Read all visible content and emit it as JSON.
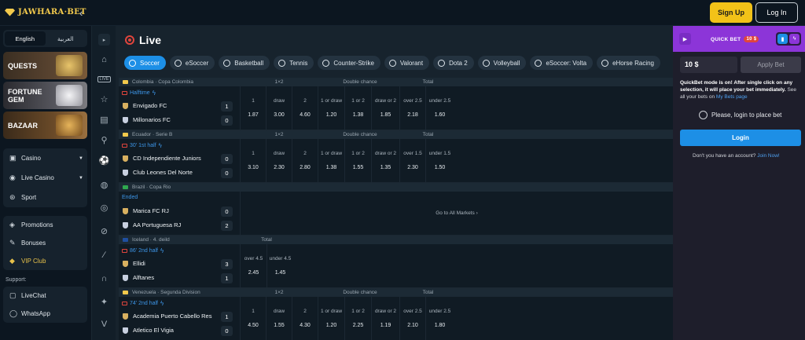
{
  "header": {
    "logo": "JAWHARA·BET",
    "collapse_icon": "chevron-left-icon",
    "signup": "Sign Up",
    "login": "Log In"
  },
  "sidebar": {
    "languages": [
      "English",
      "العربية"
    ],
    "promos": [
      "QUESTS",
      "FORTUNE GEM",
      "BAZAAR"
    ],
    "main_menu": [
      {
        "label": "Casino",
        "icon": "casino-icon"
      },
      {
        "label": "Live Casino",
        "icon": "live-casino-icon"
      },
      {
        "label": "Sport",
        "icon": "sport-icon"
      }
    ],
    "promo_menu": [
      {
        "label": "Promotions",
        "icon": "promotions-icon"
      },
      {
        "label": "Bonuses",
        "icon": "bonuses-icon"
      },
      {
        "label": "VIP Club",
        "icon": "vip-icon"
      }
    ],
    "support_label": "Support:",
    "support_menu": [
      {
        "label": "LiveChat",
        "icon": "chat-icon"
      },
      {
        "label": "WhatsApp",
        "icon": "whatsapp-icon"
      }
    ]
  },
  "iconbar": {
    "live_label": "LIVE"
  },
  "main": {
    "title": "Live",
    "sports": [
      "Soccer",
      "eSoccer",
      "Basketball",
      "Tennis",
      "Counter-Strike",
      "Valorant",
      "Dota 2",
      "Volleyball",
      "eSoccer: Volta",
      "eHorse Racing"
    ],
    "events": [
      {
        "league": "Colombia · Copa Colombia",
        "status": "Halftime",
        "home": "Envigado FC",
        "away": "Millonarios FC",
        "home_score": "1",
        "away_score": "0",
        "headers": [
          "1×2",
          "Double chance",
          "Total"
        ],
        "odds": [
          [
            "1",
            "1.87"
          ],
          [
            "draw",
            "3.00"
          ],
          [
            "2",
            "4.60"
          ],
          [
            "1 or draw",
            "1.20"
          ],
          [
            "1 or 2",
            "1.38"
          ],
          [
            "draw or 2",
            "1.85"
          ],
          [
            "over 2.5",
            "2.18"
          ],
          [
            "under 2.5",
            "1.60"
          ]
        ]
      },
      {
        "league": "Ecuador · Serie B",
        "status": "30' 1st half",
        "home": "CD Independiente Juniors",
        "away": "Club Leones Del Norte",
        "home_score": "0",
        "away_score": "0",
        "headers": [
          "1×2",
          "Double chance",
          "Total"
        ],
        "odds": [
          [
            "1",
            "3.10"
          ],
          [
            "draw",
            "2.30"
          ],
          [
            "2",
            "2.80"
          ],
          [
            "1 or draw",
            "1.38"
          ],
          [
            "1 or 2",
            "1.55"
          ],
          [
            "draw or 2",
            "1.35"
          ],
          [
            "over 1.5",
            "2.30"
          ],
          [
            "under 1.5",
            "1.50"
          ]
        ]
      },
      {
        "league": "Brazil · Copa Rio",
        "status": "Ended",
        "home": "Marica FC RJ",
        "away": "AA Portuguesa RJ",
        "home_score": "0",
        "away_score": "2",
        "goto": "Go to All Markets"
      },
      {
        "league": "Iceland · 4. deild",
        "status": "86' 2nd half",
        "home": "Ellidi",
        "away": "Alftanes",
        "home_score": "3",
        "away_score": "1",
        "headers": [
          "Total"
        ],
        "odds": [
          [
            "over 4.5",
            "2.45"
          ],
          [
            "under 4.5",
            "1.45"
          ]
        ]
      },
      {
        "league": "Venezuela · Segunda Division",
        "status": "74' 2nd half",
        "home": "Academia Puerto Cabello Res",
        "away": "Atletico El Vigia",
        "home_score": "1",
        "away_score": "0",
        "headers": [
          "1×2",
          "Double chance",
          "Total"
        ],
        "odds": [
          [
            "1",
            "4.50"
          ],
          [
            "draw",
            "1.55"
          ],
          [
            "2",
            "4.30"
          ],
          [
            "1 or draw",
            "1.20"
          ],
          [
            "1 or 2",
            "2.25"
          ],
          [
            "draw or 2",
            "1.19"
          ],
          [
            "over 2.5",
            "2.10"
          ],
          [
            "under 2.5",
            "1.80"
          ]
        ]
      }
    ]
  },
  "betslip": {
    "title": "QUICK BET",
    "badge": "10 $",
    "amount": "10 $",
    "apply": "Apply Bet",
    "note1": "QuickBet mode is on! After single click on any selection, it will place your bet immediately.",
    "note2": "See all your bets on",
    "note_link": "My Bets page",
    "please": "Please, login to place bet",
    "login": "Login",
    "no_account": "Don't you have an account?",
    "join": "Join Now!"
  }
}
